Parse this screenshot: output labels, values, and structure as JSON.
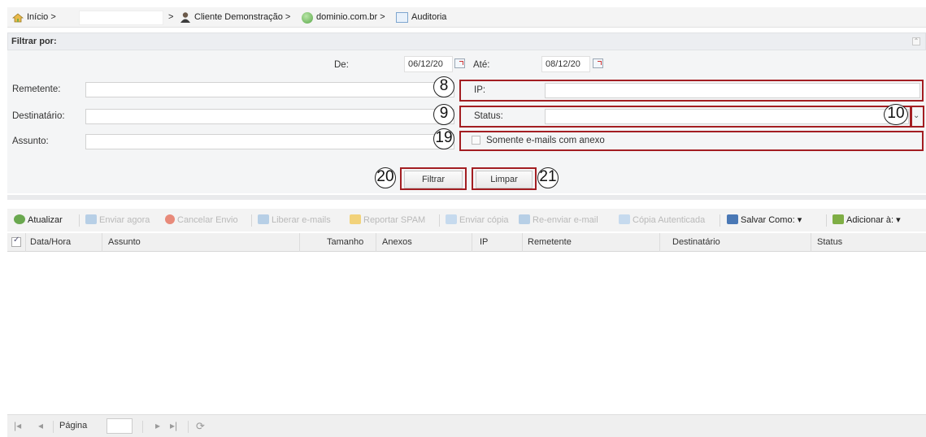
{
  "breadcrumb": {
    "home": "Início >",
    "sep1": ">",
    "client": "Cliente Demonstração >",
    "domain": "dominio.com.br >",
    "current": "Auditoria"
  },
  "filter": {
    "title": "Filtrar por:",
    "from_label": "De:",
    "from_value": "06/12/20",
    "to_label": "Até:",
    "to_value": "08/12/20",
    "sender_label": "Remetente:",
    "recipient_label": "Destinatário:",
    "subject_label": "Assunto:",
    "ip_label": "IP:",
    "status_label": "Status:",
    "attach_label": "Somente e-mails com anexo",
    "filter_button": "Filtrar",
    "clear_button": "Limpar"
  },
  "annotations": {
    "ip": "8",
    "status": "9",
    "status_dropdown": "10",
    "attach": "19",
    "filter_button": "20",
    "clear_button": "21"
  },
  "toolbar": {
    "refresh": "Atualizar",
    "send_now": "Enviar agora",
    "cancel_send": "Cancelar Envio",
    "release": "Liberar e-mails",
    "report_spam": "Reportar SPAM",
    "send_copy": "Enviar cópia",
    "resend": "Re-enviar e-mail",
    "certified_copy": "Cópia Autenticada",
    "save_as": "Salvar Como: ▾",
    "add_to": "Adicionar à: ▾"
  },
  "grid": {
    "columns": [
      "Data/Hora",
      "Assunto",
      "Tamanho",
      "Anexos",
      "IP",
      "Remetente",
      "Destinatário",
      "Status"
    ]
  },
  "pager": {
    "page_label": "Página"
  },
  "colors": {
    "highlight": "#a31e22",
    "panel": "#f4f5f6"
  }
}
